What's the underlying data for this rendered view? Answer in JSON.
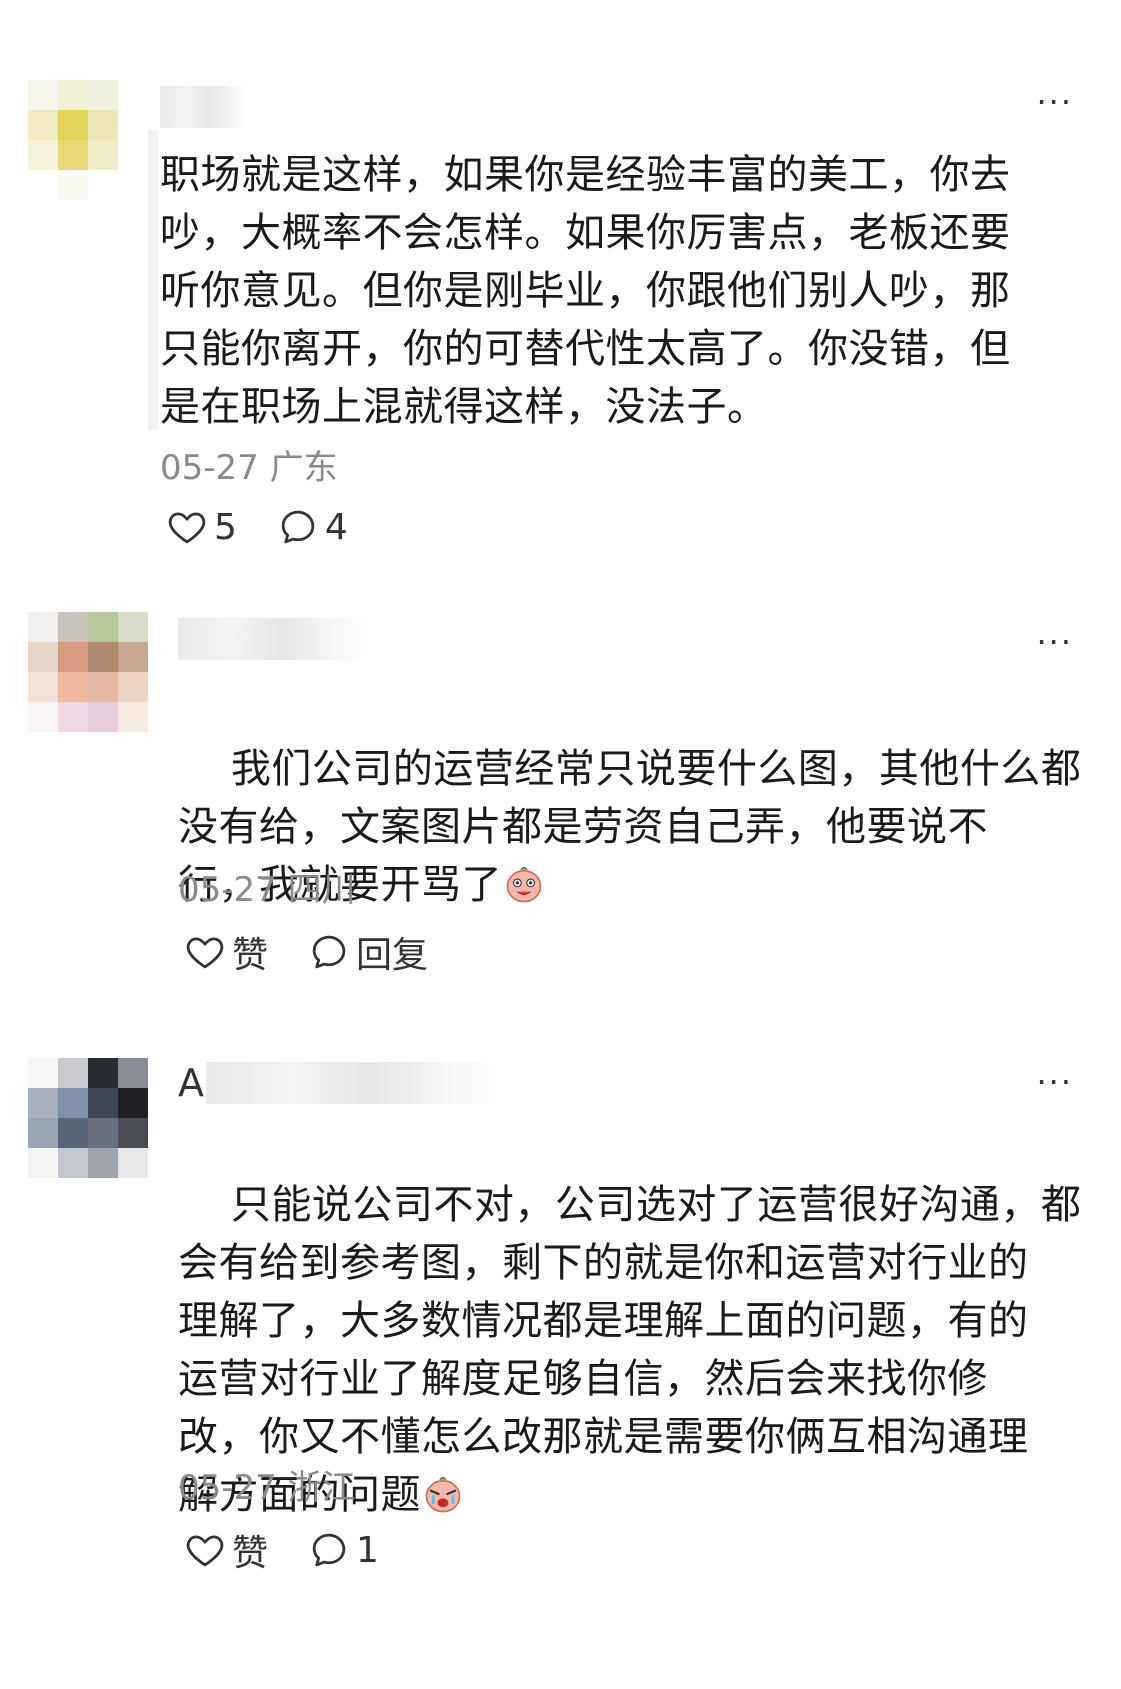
{
  "comments": [
    {
      "text": "职场就是这样，如果你是经验丰富的美工，你去\n吵，大概率不会怎样。如果你厉害点，老板还要\n听你意见。但你是刚毕业，你跟他们别人吵，那\n只能你离开，你的可替代性太高了。你没错，但\n是在职场上混就得这样，没法子。",
      "date": "05-27",
      "location": "广东",
      "like_label": "5",
      "reply_label": "4",
      "more": "···"
    },
    {
      "text": "我们公司的运营经常只说要什么图，其他什么都\n没有给，文案图片都是劳资自己弄，他要说不\n行，我就要开骂了",
      "date": "05-27",
      "location": "四川",
      "like_label": "赞",
      "reply_label": "回复",
      "more": "···"
    },
    {
      "username_prefix": "A",
      "text": "只能说公司不对，公司选对了运营很好沟通，都\n会有给到参考图，剩下的就是你和运营对行业的\n理解了，大多数情况都是理解上面的问题，有的\n运营对行业了解度足够自信，然后会来找你修\n改，你又不懂怎么改那就是需要你俩互相沟通理\n解方面的问题",
      "date": "05-27",
      "location": "浙江",
      "like_label": "赞",
      "reply_label": "1",
      "more": "···"
    }
  ],
  "icons": {
    "like": "heart-outline-icon",
    "reply": "speech-bubble-icon",
    "emoji2": "tongue-out-emoji-icon",
    "emoji3": "crying-emoji-icon"
  }
}
